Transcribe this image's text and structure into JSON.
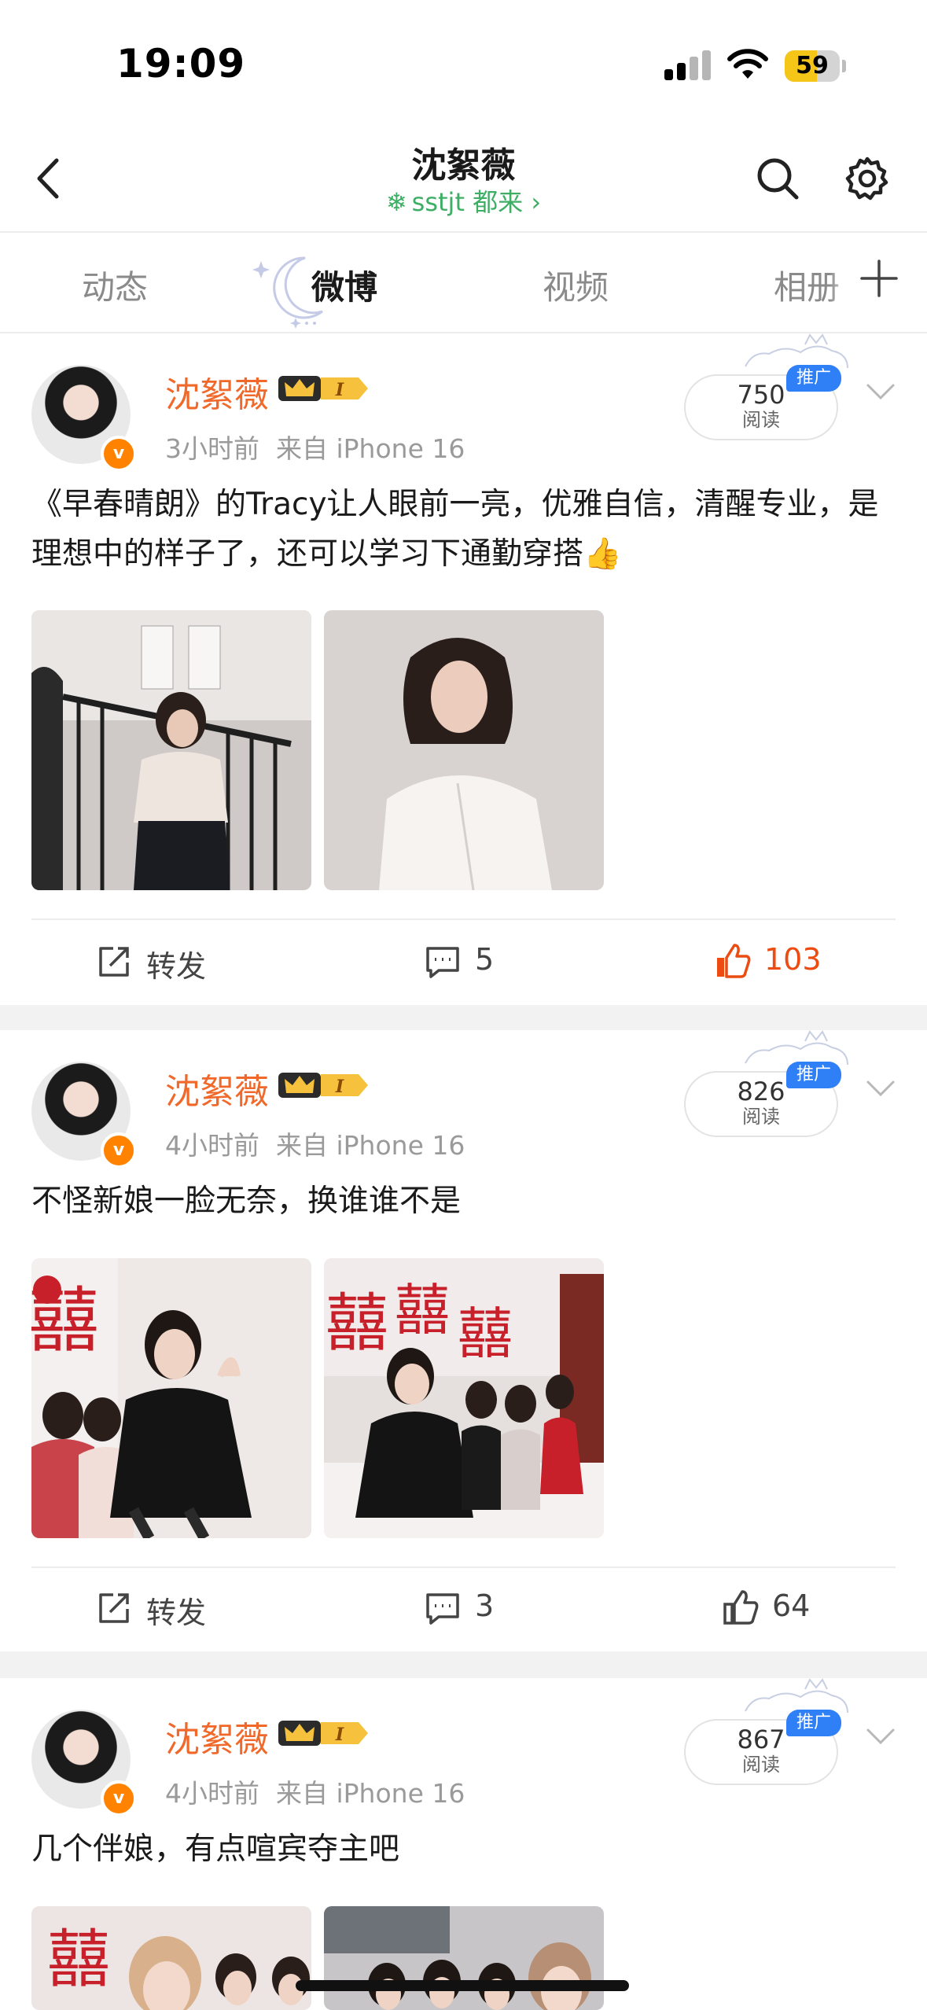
{
  "status_bar": {
    "time": "19:09",
    "battery_level": "59",
    "battery_fraction": 0.59
  },
  "header": {
    "title": "沈絮薇",
    "subtitle": "sstjt 都来 ›"
  },
  "tabs": [
    {
      "label": "动态",
      "active": false
    },
    {
      "label": "微博",
      "active": true
    },
    {
      "label": "视频",
      "active": false
    },
    {
      "label": "相册",
      "active": false
    }
  ],
  "posts": [
    {
      "author": "沈絮薇",
      "badge_text": "I",
      "time": "3小时前",
      "source": "来自 iPhone 16",
      "reads": "750",
      "reads_label": "阅读",
      "promo": "推广",
      "text": "《早春晴朗》的Tracy让人眼前一亮，优雅自信，清醒专业，是理想中的样子了，还可以学习下通勤穿搭👍",
      "repost_label": "转发",
      "comments": "5",
      "likes": "103",
      "liked": true
    },
    {
      "author": "沈絮薇",
      "badge_text": "I",
      "time": "4小时前",
      "source": "来自 iPhone 16",
      "reads": "826",
      "reads_label": "阅读",
      "promo": "推广",
      "text": "不怪新娘一脸无奈，换谁谁不是",
      "repost_label": "转发",
      "comments": "3",
      "likes": "64",
      "liked": false
    },
    {
      "author": "沈絮薇",
      "badge_text": "I",
      "time": "4小时前",
      "source": "来自 iPhone 16",
      "reads": "867",
      "reads_label": "阅读",
      "promo": "推广",
      "text": "几个伴娘，有点喧宾夺主吧"
    }
  ],
  "colors": {
    "author_orange": "#f0692a",
    "liked_red": "#ec4b12",
    "promo_blue": "#2f7ff6",
    "subtitle_green": "#3fae65"
  },
  "icons": [
    "back-icon",
    "search-icon",
    "gear-icon",
    "plus-icon",
    "chevron-down-icon",
    "repost-icon",
    "comment-icon",
    "like-icon",
    "verified-icon",
    "crown-icon",
    "snowflake-icon",
    "moon-icon",
    "wifi-icon",
    "signal-icon",
    "battery-icon"
  ]
}
